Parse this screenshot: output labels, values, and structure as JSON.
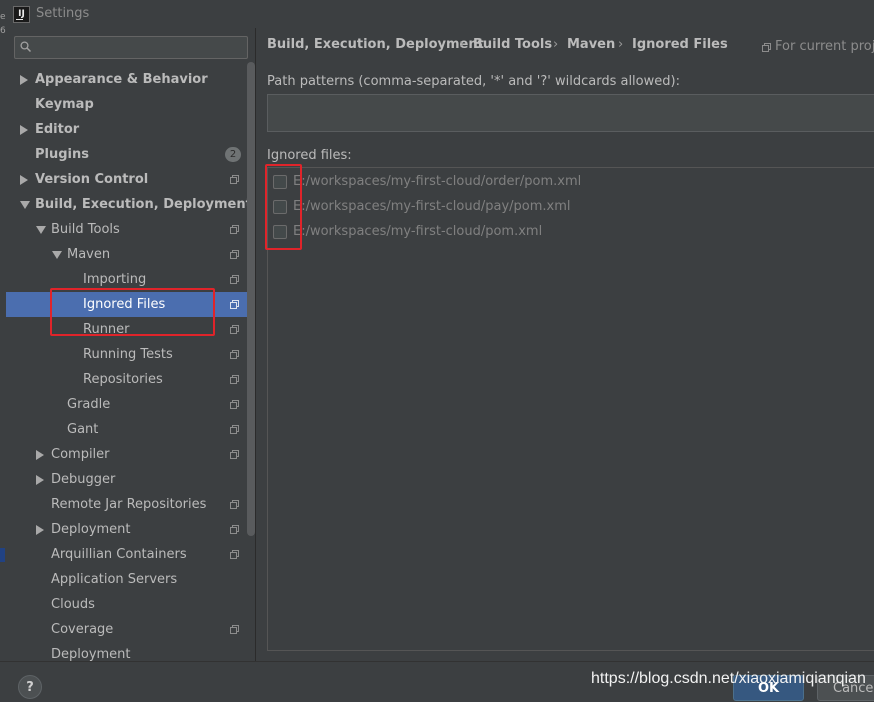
{
  "window": {
    "title": "Settings",
    "icon": "IJ",
    "edge_text": "e 6"
  },
  "search": {
    "placeholder": "",
    "icon": "search-icon"
  },
  "sidebar": {
    "items": [
      {
        "label": "Appearance & Behavior",
        "level": 0,
        "arrow": "right",
        "bold": true
      },
      {
        "label": "Keymap",
        "level": 0,
        "arrow": "",
        "bold": true
      },
      {
        "label": "Editor",
        "level": 0,
        "arrow": "right",
        "bold": true
      },
      {
        "label": "Plugins",
        "level": 0,
        "arrow": "",
        "bold": true,
        "badge": "2"
      },
      {
        "label": "Version Control",
        "level": 0,
        "arrow": "right",
        "bold": true,
        "proj": true
      },
      {
        "label": "Build, Execution, Deployment",
        "level": 0,
        "arrow": "down",
        "bold": true
      },
      {
        "label": "Build Tools",
        "level": 1,
        "arrow": "down",
        "proj": true
      },
      {
        "label": "Maven",
        "level": 2,
        "arrow": "down",
        "proj": true
      },
      {
        "label": "Importing",
        "level": 3,
        "arrow": "",
        "proj": true
      },
      {
        "label": "Ignored Files",
        "level": 3,
        "arrow": "",
        "proj": true,
        "selected": true
      },
      {
        "label": "Runner",
        "level": 3,
        "arrow": "",
        "proj": true
      },
      {
        "label": "Running Tests",
        "level": 3,
        "arrow": "",
        "proj": true
      },
      {
        "label": "Repositories",
        "level": 3,
        "arrow": "",
        "proj": true
      },
      {
        "label": "Gradle",
        "level": 2,
        "arrow": "",
        "proj": true
      },
      {
        "label": "Gant",
        "level": 2,
        "arrow": "",
        "proj": true
      },
      {
        "label": "Compiler",
        "level": 1,
        "arrow": "right",
        "proj": true
      },
      {
        "label": "Debugger",
        "level": 1,
        "arrow": "right"
      },
      {
        "label": "Remote Jar Repositories",
        "level": 1,
        "arrow": "",
        "proj": true
      },
      {
        "label": "Deployment",
        "level": 1,
        "arrow": "right",
        "proj": true
      },
      {
        "label": "Arquillian Containers",
        "level": 1,
        "arrow": "",
        "proj": true
      },
      {
        "label": "Application Servers",
        "level": 1,
        "arrow": ""
      },
      {
        "label": "Clouds",
        "level": 1,
        "arrow": ""
      },
      {
        "label": "Coverage",
        "level": 1,
        "arrow": "",
        "proj": true
      },
      {
        "label": "Deployment",
        "level": 1,
        "arrow": ""
      }
    ]
  },
  "breadcrumb": [
    "Build, Execution, Deployment",
    "Build Tools",
    "Maven",
    "Ignored Files"
  ],
  "breadcrumb_separator": "›",
  "scope": {
    "label": "For current proj",
    "icon": "project-scope-icon"
  },
  "path_patterns": {
    "label": "Path patterns (comma-separated, '*' and '?' wildcards allowed):",
    "value": ""
  },
  "ignored_files": {
    "label": "Ignored files:",
    "items": [
      {
        "path": "E:/workspaces/my-first-cloud/order/pom.xml",
        "checked": false
      },
      {
        "path": "E:/workspaces/my-first-cloud/pay/pom.xml",
        "checked": false
      },
      {
        "path": "E:/workspaces/my-first-cloud/pom.xml",
        "checked": false
      }
    ]
  },
  "footer": {
    "help_label": "?",
    "ok_label": "OK",
    "cancel_label": "Cancel"
  },
  "watermark": "https://blog.csdn.net/xiaoxiamiqianqian",
  "colors": {
    "selection": "#4b6eaf",
    "highlight": "#e0242a",
    "background": "#3c3f41"
  }
}
